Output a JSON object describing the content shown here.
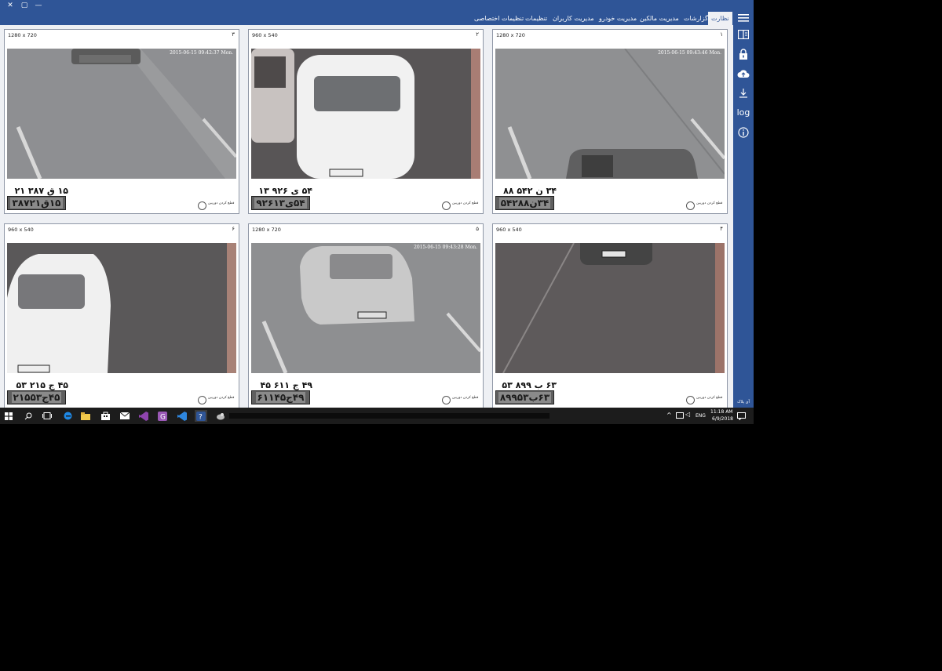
{
  "titlebar": {
    "minimize": "—",
    "restore": "▢",
    "close": "✕"
  },
  "nav": {
    "tabs": [
      {
        "label": "نظارت",
        "active": true
      },
      {
        "label": "گزارشات"
      },
      {
        "label": "مدیریت مالکین"
      },
      {
        "label": "مدیریت خودرو"
      },
      {
        "label": "مدیریت کاربران"
      },
      {
        "label": "تنظیمات"
      },
      {
        "label": "تنظیمات اختصاصی"
      }
    ]
  },
  "sidebar": {
    "icons": [
      "menu-icon",
      "panel-layout-icon",
      "lock-icon",
      "cloud-upload-icon",
      "download-icon",
      "log-icon",
      "info-icon"
    ],
    "log_label": "log",
    "footer": "آی پلاک"
  },
  "panels": [
    {
      "res": "1280 x 720",
      "num": "۳",
      "stamp": "2015-06-15 09:42:37 Mon.",
      "plate": "۱۵ ق ۳۸۷ ۲۱",
      "plate_img": "۱۵ق۳۸۷۲۱",
      "btn": "قطع کردن دوربین"
    },
    {
      "res": "960 x 540",
      "num": "۲",
      "stamp": "",
      "plate": "۵۴ ی ۹۲۶ ۱۳",
      "plate_img": "۵۴ی۹۲۶۱۳",
      "btn": "قطع کردن دوربین"
    },
    {
      "res": "1280 x 720",
      "num": "۱",
      "stamp": "2015-06-15 09:43:46 Mon.",
      "plate": "۳۴ ن ۵۴۲ ۸۸",
      "plate_img": "۳۴ن۵۴۲۸۸",
      "btn": "قطع کردن دوربین"
    },
    {
      "res": "960 x 540",
      "num": "۶",
      "stamp": "",
      "plate": "۴۵ ج ۲۱۵ ۵۳",
      "plate_img": "۴۵ج۲۱۵۵۳",
      "btn": "قطع کردن دوربین"
    },
    {
      "res": "1280 x 720",
      "num": "۵",
      "stamp": "2015-06-15 09:43:28 Mon.",
      "plate": "۴۹ ج ۶۱۱ ۴۵",
      "plate_img": "۴۹ج۶۱۱۴۵",
      "btn": "قطع کردن دوربین"
    },
    {
      "res": "960 x 540",
      "num": "۴",
      "stamp": "",
      "plate": "۶۳ ب ۸۹۹ ۵۳",
      "plate_img": "۶۳ب۸۹۹۵۳",
      "btn": "قطع کردن دوربین"
    }
  ],
  "taskbar": {
    "icons": [
      "windows-start-icon",
      "search-icon",
      "task-view-icon",
      "edge-icon",
      "file-explorer-icon",
      "store-icon",
      "mail-icon",
      "visual-studio-icon",
      "app-icon-purple",
      "vscode-icon",
      "app-icon-active",
      "app-icon-bird"
    ],
    "lang": "ENG",
    "time": "11:18 AM",
    "date": "6/9/2018"
  }
}
